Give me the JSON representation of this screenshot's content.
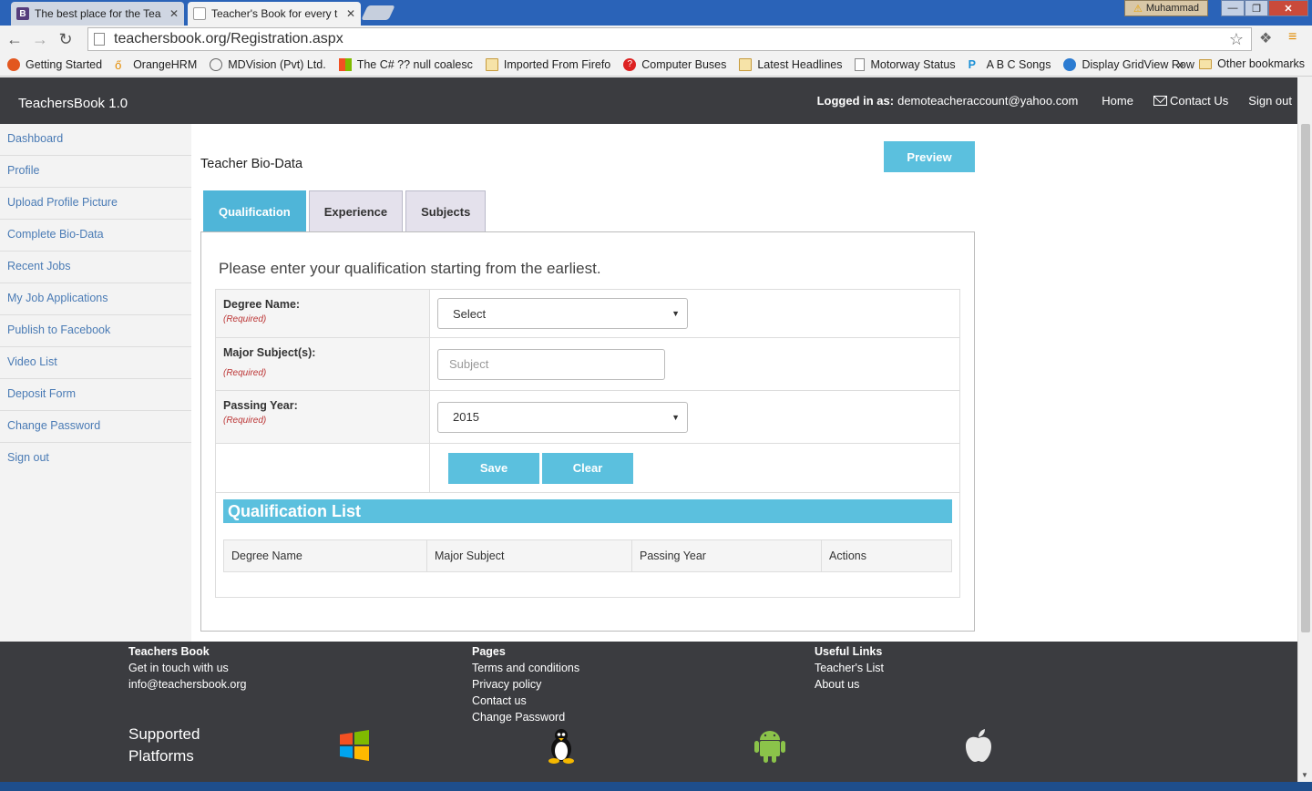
{
  "browser": {
    "tabs": [
      {
        "title": "The best place for the Tea",
        "favicon": "B",
        "active": false
      },
      {
        "title": "Teacher's Book for every t",
        "favicon": "",
        "active": true
      }
    ],
    "user": "Muhammad",
    "url": "teachersbook.org/Registration.aspx",
    "bookmarks": [
      "Getting Started",
      "OrangeHRM",
      "MDVision (Pvt) Ltd.",
      "The C# ?? null coalesc",
      "Imported From Firefo",
      "Computer Buses",
      "Latest Headlines",
      "Motorway Status",
      "A B C Songs",
      "Display GridView Row"
    ],
    "bookmarks_more": "»",
    "other_bookmarks": "Other bookmarks"
  },
  "header": {
    "brand": "TeachersBook 1.0",
    "logged_label": "Logged in as:",
    "email": "demoteacheraccount@yahoo.com",
    "home": "Home",
    "contact": "Contact Us",
    "signout": "Sign out"
  },
  "sidebar": {
    "items": [
      "Dashboard",
      "Profile",
      "Upload Profile Picture",
      "Complete Bio-Data",
      "Recent Jobs",
      "My Job Applications",
      "Publish to Facebook",
      "Video List",
      "Deposit Form",
      "Change Password",
      "Sign out"
    ]
  },
  "main": {
    "title": "Teacher Bio-Data",
    "preview": "Preview",
    "tabs": [
      "Qualification",
      "Experience",
      "Subjects"
    ],
    "instruction": "Please enter your qualification starting from the earliest.",
    "form": {
      "degree_label": "Degree Name:",
      "degree_value": "Select",
      "major_label": "Major Subject(s):",
      "major_placeholder": "Subject",
      "year_label": "Passing Year:",
      "year_value": "2015",
      "required": "(Required)",
      "save": "Save",
      "clear": "Clear"
    },
    "list_title": "Qualification List",
    "columns": [
      "Degree Name",
      "Major Subject",
      "Passing Year",
      "Actions"
    ]
  },
  "footer": {
    "col1": {
      "heading": "Teachers Book",
      "lines": [
        "Get in touch with us",
        "info@teachersbook.org"
      ]
    },
    "col2": {
      "heading": "Pages",
      "links": [
        "Terms and conditions",
        "Privacy policy",
        "Contact us",
        "Change Password"
      ]
    },
    "col3": {
      "heading": "Useful Links",
      "links": [
        "Teacher's List",
        "About us"
      ]
    },
    "platforms_line1": "Supported",
    "platforms_line2": "Platforms",
    "platform_icons": [
      "windows-icon",
      "linux-icon",
      "android-icon",
      "apple-icon"
    ]
  },
  "colors": {
    "accent": "#5bc0de",
    "header_bg": "#3b3c40",
    "link": "#4a7bb5"
  }
}
